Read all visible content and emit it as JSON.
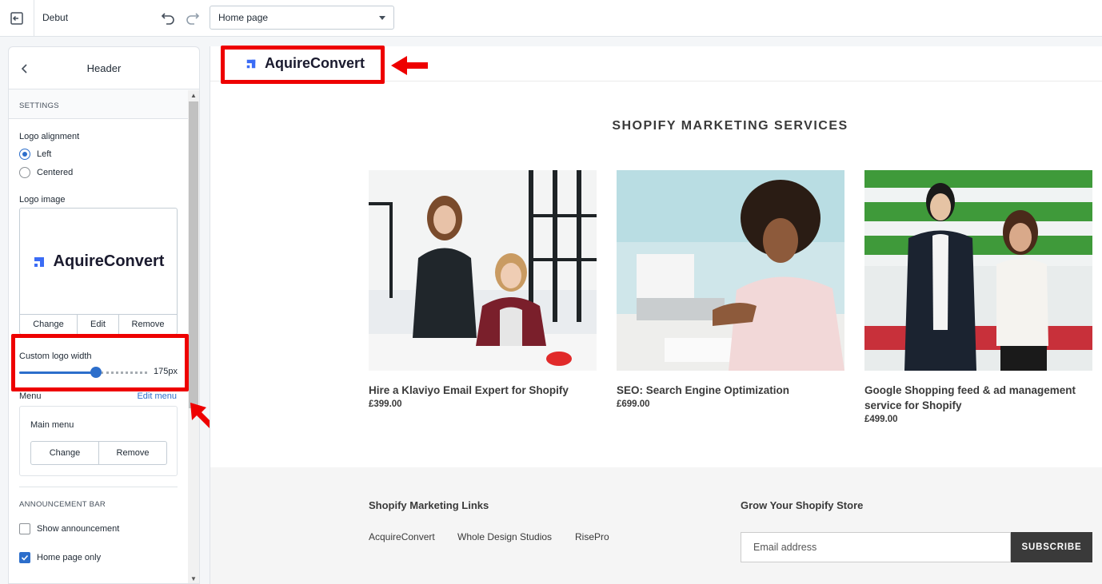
{
  "topbar": {
    "theme_name": "Debut",
    "page_select": "Home page"
  },
  "sidebar": {
    "title": "Header",
    "settings_heading": "SETTINGS",
    "logo_alignment_label": "Logo alignment",
    "alignment_options": [
      {
        "label": "Left",
        "checked": true
      },
      {
        "label": "Centered",
        "checked": false
      }
    ],
    "logo_image_label": "Logo image",
    "logo_text": "AquireConvert",
    "logo_buttons": [
      "Change",
      "Edit",
      "Remove"
    ],
    "custom_logo_width_label": "Custom logo width",
    "custom_logo_width_value": "175px",
    "custom_logo_width_fraction": 0.6,
    "menu_label": "Menu",
    "edit_menu_link": "Edit menu",
    "main_menu_label": "Main menu",
    "menu_buttons": [
      "Change",
      "Remove"
    ],
    "announcement_heading": "ANNOUNCEMENT BAR",
    "show_announcement": {
      "label": "Show announcement",
      "checked": false
    },
    "home_page_only": {
      "label": "Home page only",
      "checked": true
    }
  },
  "store": {
    "logo_text": "AquireConvert",
    "collection_title": "SHOPIFY MARKETING SERVICES",
    "products": [
      {
        "name": "Hire a Klaviyo Email Expert for Shopify",
        "price": "£399.00"
      },
      {
        "name": "SEO: Search Engine Optimization",
        "price": "£699.00"
      },
      {
        "name": "Google Shopping feed & ad management service for Shopify",
        "price": "£499.00"
      }
    ],
    "footer": {
      "links_heading": "Shopify Marketing Links",
      "links": [
        "AcquireConvert",
        "Whole Design Studios",
        "RisePro"
      ],
      "grow_heading": "Grow Your Shopify Store",
      "email_placeholder": "Email address",
      "subscribe_label": "SUBSCRIBE"
    }
  },
  "colors": {
    "accent": "#2c6ecb",
    "highlight": "#e00000",
    "logo_blue": "#3b6cf5"
  }
}
